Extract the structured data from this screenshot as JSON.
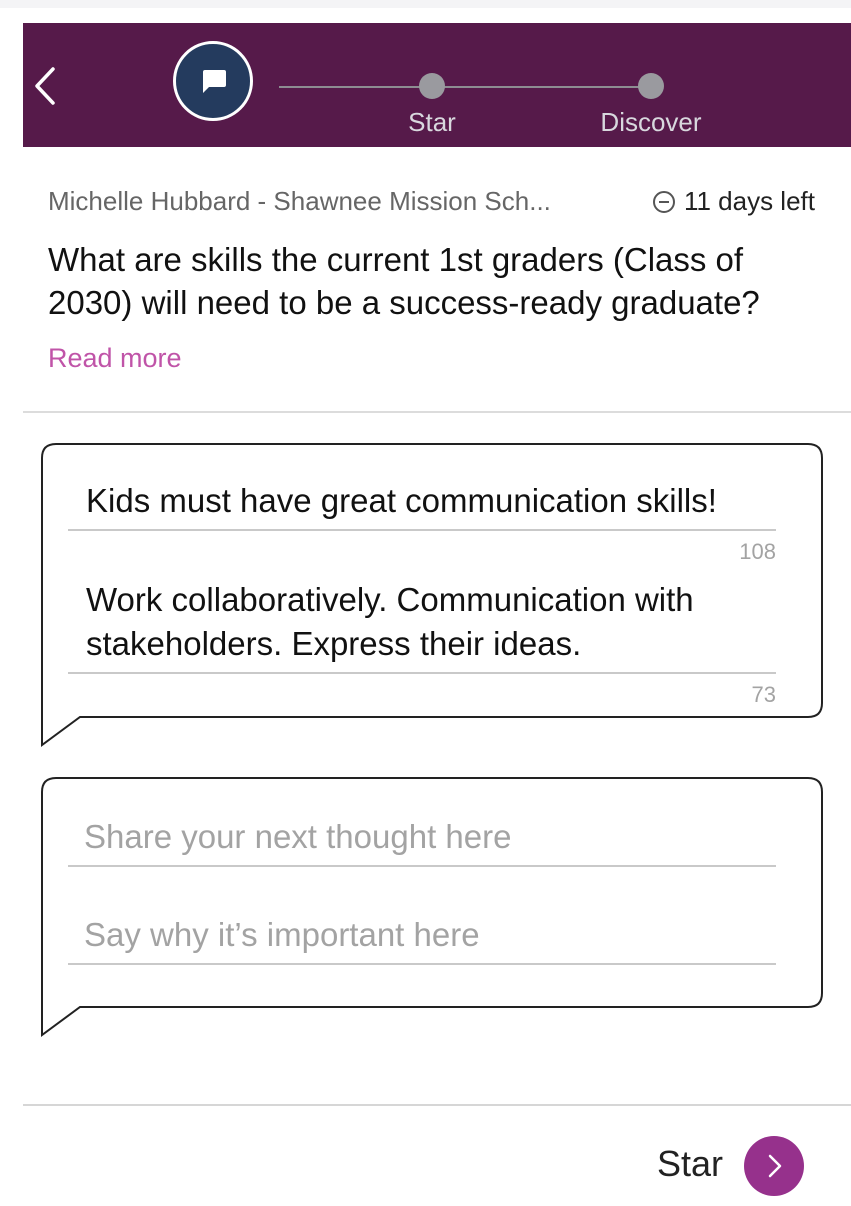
{
  "nav": {
    "steps": [
      {
        "label": ""
      },
      {
        "label": "Star"
      },
      {
        "label": "Discover"
      }
    ]
  },
  "post": {
    "author": "Michelle Hubbard - Shawnee Mission Sch...",
    "time_left": "11 days left",
    "question": "What are skills the current 1st graders (Class of 2030) will need to be a success-ready graduate?",
    "read_more": "Read more"
  },
  "thoughts": [
    {
      "title": "Kids must have great communication skills!",
      "title_counter": "108",
      "reason": "Work collaboratively. Communication with stakeholders.  Express their ideas.",
      "reason_counter": "73"
    }
  ],
  "new_thought": {
    "title_placeholder": "Share your next thought here",
    "reason_placeholder": "Say why it’s important here"
  },
  "footer": {
    "next_label": "Star"
  },
  "colors": {
    "header_bg": "#561a4a",
    "active_step": "#243b5e",
    "accent": "#96318c",
    "link": "#c054a8"
  },
  "icons": [
    "back-chevron-icon",
    "chat-bubble-icon",
    "clock-icon",
    "chevron-right-icon"
  ]
}
